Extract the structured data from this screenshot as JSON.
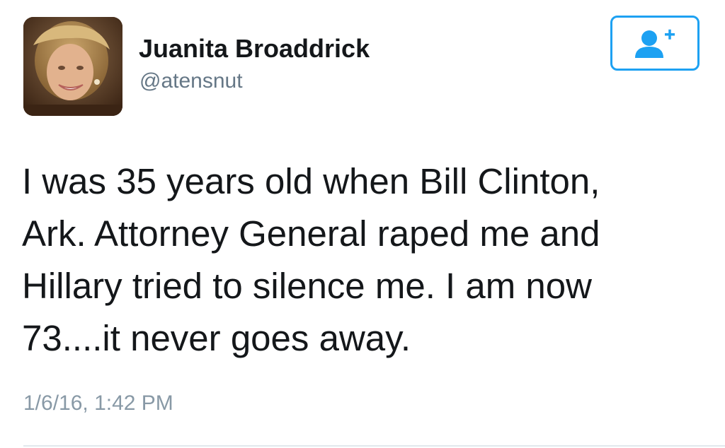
{
  "user": {
    "display_name": "Juanita Broaddrick",
    "handle": "@atensnut",
    "avatar": "profile-photo"
  },
  "follow_button": {
    "icon": "add-user-icon",
    "color": "#1da1f2"
  },
  "tweet": {
    "lines": [
      "I was 35 years old when Bill Clinton,",
      "Ark. Attorney General raped me and",
      "Hillary tried to silence me.  I am now",
      "73....it never goes away."
    ],
    "timestamp": "1/6/16, 1:42 PM"
  },
  "colors": {
    "text": "#14171a",
    "secondary_text": "#657786",
    "timestamp": "#8899a6",
    "accent": "#1da1f2",
    "divider": "#e1e8ed"
  }
}
